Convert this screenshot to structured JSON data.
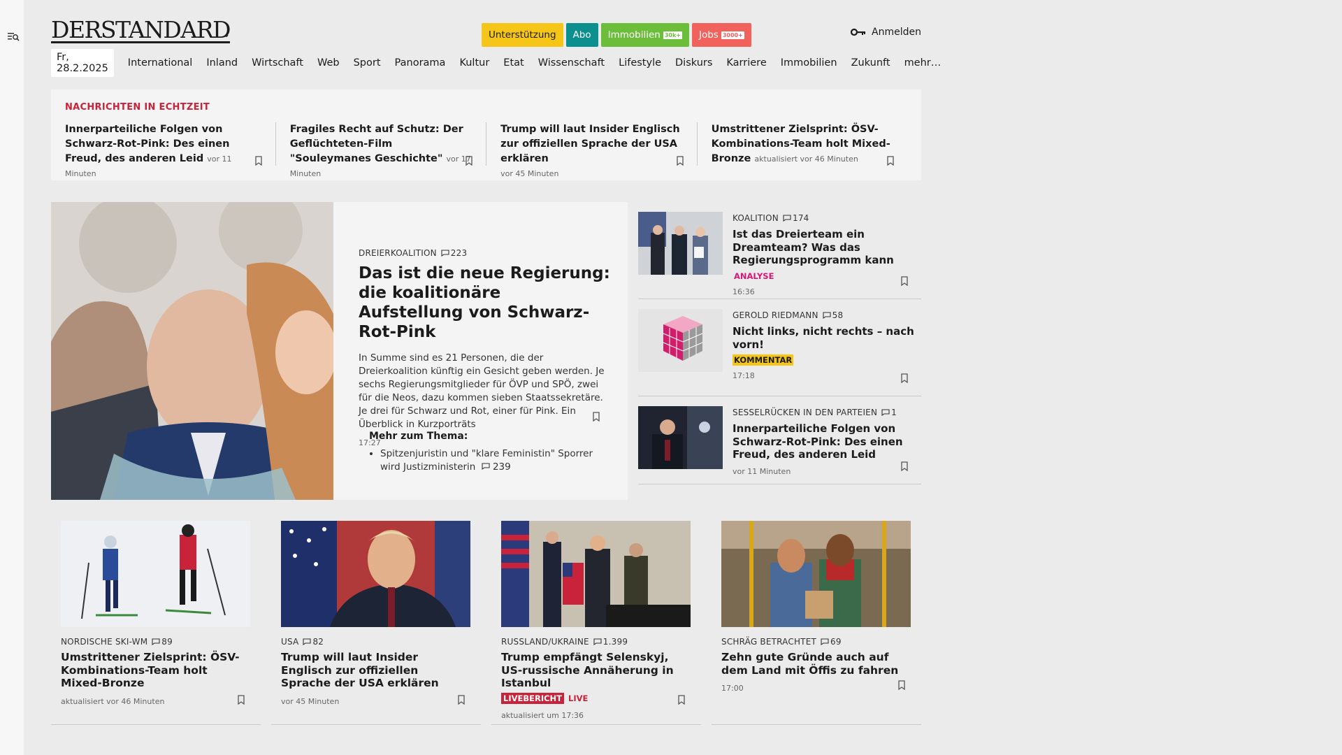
{
  "header": {
    "logo": "DERSTANDARD",
    "pills": [
      {
        "label": "Unterstützung",
        "tag": "",
        "color": "#f5c518",
        "text": "#1b1b1b"
      },
      {
        "label": "Abo",
        "tag": "",
        "color": "#0b8f8f",
        "text": "#ffffff"
      },
      {
        "label": "Immobilien",
        "tag": "30k+",
        "color": "#6bbd3a",
        "text": "#ffffff"
      },
      {
        "label": "Jobs",
        "tag": "3000+",
        "color": "#f0625b",
        "text": "#ffffff"
      }
    ],
    "login": "Anmelden"
  },
  "nav": {
    "date": "Fr, 28.2.2025",
    "items": [
      "International",
      "Inland",
      "Wirtschaft",
      "Web",
      "Sport",
      "Panorama",
      "Kultur",
      "Etat",
      "Wissenschaft",
      "Lifestyle",
      "Diskurs",
      "Karriere",
      "Immobilien",
      "Zukunft",
      "mehr…"
    ]
  },
  "ticker": {
    "title": "NACHRICHTEN IN ECHTZEIT",
    "items": [
      {
        "title": "Innerparteiliche Folgen von Schwarz-Rot-Pink: Des einen Freud, des anderen Leid",
        "time": "vor 11 Minuten"
      },
      {
        "title": "Fragiles Recht auf Schutz: Der Geflüchteten-Film \"Souleymanes Geschichte\"",
        "time": "vor 17 Minuten"
      },
      {
        "title": "Trump will laut Insider Englisch zur offiziellen Sprache der USA erklären",
        "time": "vor 45 Minuten"
      },
      {
        "title": "Umstrittener Zielsprint: ÖSV-Kombinations-Team holt Mixed-Bronze",
        "time": "aktualisiert vor 46 Minuten"
      }
    ]
  },
  "lead": {
    "kicker": "DREIERKOALITION",
    "comments": "223",
    "title": "Das ist die neue Regierung: die koalitionäre Aufstellung von Schwarz-Rot-Pink",
    "summary": "In Summe sind es 21 Personen, die der Dreierkoalition künftig ein Gesicht geben werden. Je sechs Regierungsmitglieder für ÖVP und SPÖ, zwei für die Neos, dazu kommen sieben Staatssekretäre. Je drei für Schwarz und Rot, einer für Pink. Ein Überblick in Kurzporträts",
    "time": "17:27",
    "more_title": "Mehr zum Thema:",
    "more_item": "Spitzenjuristin und \"klare Feministin\" Sporrer wird Justizministerin",
    "more_comments": "239"
  },
  "side": [
    {
      "kicker": "KOALITION",
      "comments": "174",
      "title": "Ist das Dreierteam ein Dreamteam? Was das Regierungsprogramm kann",
      "badge": "ANALYSE",
      "time": "16:36"
    },
    {
      "kicker": "GEROLD RIEDMANN",
      "comments": "58",
      "title": "Nicht links, nicht rechts – nach vorn!",
      "badge": "KOMMENTAR",
      "time": "17:18"
    },
    {
      "kicker": "SESSELRÜCKEN IN DEN PARTEIEN",
      "comments": "1",
      "title": "Innerparteiliche Folgen von Schwarz-Rot-Pink: Des einen Freud, des anderen Leid",
      "badge": "",
      "time": "vor 11 Minuten"
    }
  ],
  "cards": [
    {
      "kicker": "NORDISCHE SKI-WM",
      "comments": "89",
      "title": "Umstrittener Zielsprint: ÖSV-Kombinations-Team holt Mixed-Bronze",
      "time": "aktualisiert vor 46 Minuten"
    },
    {
      "kicker": "USA",
      "comments": "82",
      "title": "Trump will laut Insider Englisch zur offiziellen Sprache der USA erklären",
      "time": "vor 45 Minuten"
    },
    {
      "kicker": "RUSSLAND/UKRAINE",
      "comments": "1.399",
      "title": "Trump empfängt Selenskyj, US-russische Annäherung in Istanbul",
      "live_badge": "LIVEBERICHT",
      "live_text": "LIVE",
      "time": "aktualisiert um 17:36"
    },
    {
      "kicker": "SCHRÄG BETRACHTET",
      "comments": "69",
      "title": "Zehn gute Gründe auch auf dem Land mit Öffis zu fahren",
      "time": "17:00"
    }
  ]
}
